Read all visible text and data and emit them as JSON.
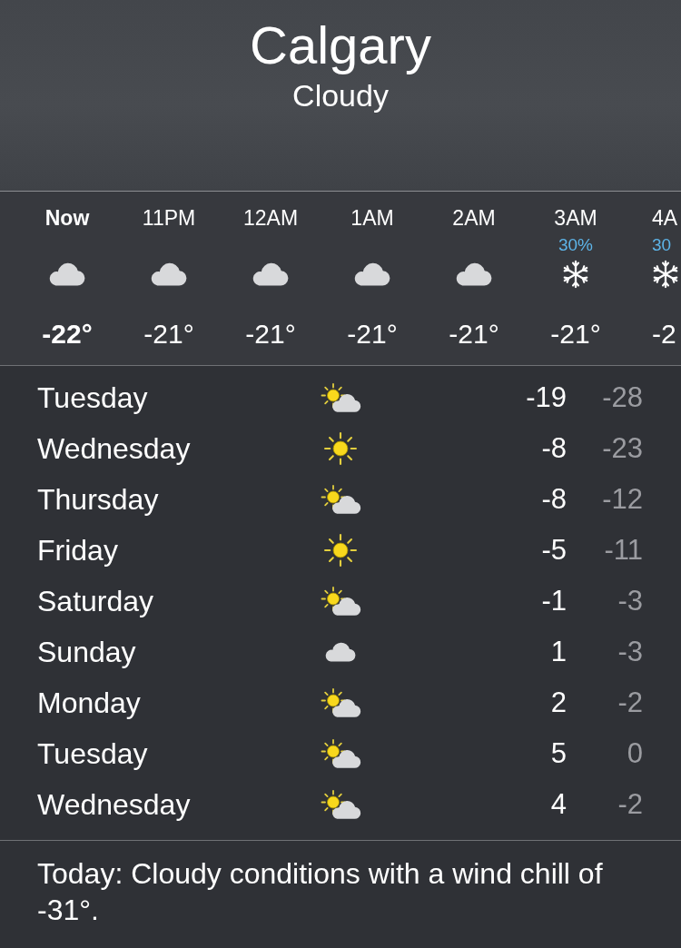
{
  "header": {
    "city": "Calgary",
    "condition": "Cloudy"
  },
  "hourly": [
    {
      "time": "Now",
      "current": true,
      "kind": "cloudy",
      "temp": "-22°"
    },
    {
      "time": "11PM",
      "current": false,
      "kind": "cloudy",
      "temp": "-21°"
    },
    {
      "time": "12AM",
      "current": false,
      "kind": "cloudy",
      "temp": "-21°"
    },
    {
      "time": "1AM",
      "current": false,
      "kind": "cloudy",
      "temp": "-21°"
    },
    {
      "time": "2AM",
      "current": false,
      "kind": "cloudy",
      "temp": "-21°"
    },
    {
      "time": "3AM",
      "current": false,
      "precip": "30%",
      "kind": "snow",
      "temp": "-21°"
    },
    {
      "time": "4A",
      "current": false,
      "precip": "30",
      "kind": "snow",
      "temp": "-2"
    }
  ],
  "daily": [
    {
      "day": "Tuesday",
      "kind": "partlycloudy",
      "high": "-19",
      "low": "-28"
    },
    {
      "day": "Wednesday",
      "kind": "sunny",
      "high": "-8",
      "low": "-23"
    },
    {
      "day": "Thursday",
      "kind": "partlycloudy",
      "high": "-8",
      "low": "-12"
    },
    {
      "day": "Friday",
      "kind": "sunny",
      "high": "-5",
      "low": "-11"
    },
    {
      "day": "Saturday",
      "kind": "partlycloudy",
      "high": "-1",
      "low": "-3"
    },
    {
      "day": "Sunday",
      "kind": "cloudy",
      "high": "1",
      "low": "-3"
    },
    {
      "day": "Monday",
      "kind": "partlycloudy",
      "high": "2",
      "low": "-2"
    },
    {
      "day": "Tuesday",
      "kind": "partlycloudy",
      "high": "5",
      "low": "0"
    },
    {
      "day": "Wednesday",
      "kind": "partlycloudy",
      "high": "4",
      "low": "-2"
    }
  ],
  "summary": "Today: Cloudy conditions with a wind chill of -31°."
}
